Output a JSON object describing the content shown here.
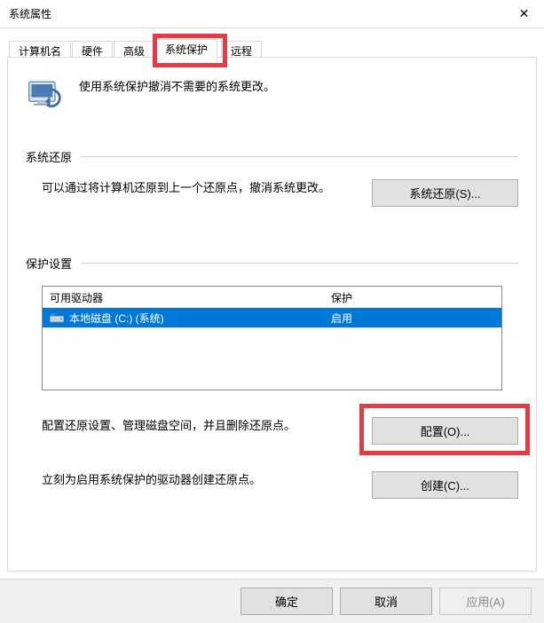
{
  "window": {
    "title": "系统属性"
  },
  "tabs": [
    {
      "label": "计算机名"
    },
    {
      "label": "硬件"
    },
    {
      "label": "高级"
    },
    {
      "label": "系统保护"
    },
    {
      "label": "远程"
    }
  ],
  "active_tab_index": 3,
  "intro": "使用系统保护撤消不需要的系统更改。",
  "section_restore": {
    "heading": "系统还原",
    "text": "可以通过将计算机还原到上一个还原点，撤消系统更改。",
    "button": "系统还原(S)..."
  },
  "section_protect": {
    "heading": "保护设置",
    "columns": {
      "drive": "可用驱动器",
      "status": "保护"
    },
    "drives": [
      {
        "name": "本地磁盘 (C:) (系统)",
        "status": "启用",
        "selected": true
      }
    ],
    "config_text": "配置还原设置、管理磁盘空间，并且删除还原点。",
    "config_button": "配置(O)...",
    "create_text": "立刻为启用系统保护的驱动器创建还原点。",
    "create_button": "创建(C)..."
  },
  "dialog_buttons": {
    "ok": "确定",
    "cancel": "取消",
    "apply": "应用(A)"
  }
}
